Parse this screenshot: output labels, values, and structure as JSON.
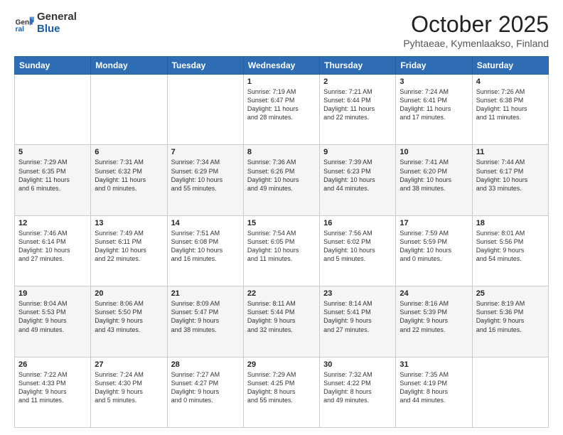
{
  "header": {
    "logo_general": "General",
    "logo_blue": "Blue",
    "title": "October 2025",
    "location": "Pyhtaeae, Kymenlaakso, Finland"
  },
  "weekdays": [
    "Sunday",
    "Monday",
    "Tuesday",
    "Wednesday",
    "Thursday",
    "Friday",
    "Saturday"
  ],
  "weeks": [
    [
      {
        "day": "",
        "info": ""
      },
      {
        "day": "",
        "info": ""
      },
      {
        "day": "",
        "info": ""
      },
      {
        "day": "1",
        "info": "Sunrise: 7:19 AM\nSunset: 6:47 PM\nDaylight: 11 hours\nand 28 minutes."
      },
      {
        "day": "2",
        "info": "Sunrise: 7:21 AM\nSunset: 6:44 PM\nDaylight: 11 hours\nand 22 minutes."
      },
      {
        "day": "3",
        "info": "Sunrise: 7:24 AM\nSunset: 6:41 PM\nDaylight: 11 hours\nand 17 minutes."
      },
      {
        "day": "4",
        "info": "Sunrise: 7:26 AM\nSunset: 6:38 PM\nDaylight: 11 hours\nand 11 minutes."
      }
    ],
    [
      {
        "day": "5",
        "info": "Sunrise: 7:29 AM\nSunset: 6:35 PM\nDaylight: 11 hours\nand 6 minutes."
      },
      {
        "day": "6",
        "info": "Sunrise: 7:31 AM\nSunset: 6:32 PM\nDaylight: 11 hours\nand 0 minutes."
      },
      {
        "day": "7",
        "info": "Sunrise: 7:34 AM\nSunset: 6:29 PM\nDaylight: 10 hours\nand 55 minutes."
      },
      {
        "day": "8",
        "info": "Sunrise: 7:36 AM\nSunset: 6:26 PM\nDaylight: 10 hours\nand 49 minutes."
      },
      {
        "day": "9",
        "info": "Sunrise: 7:39 AM\nSunset: 6:23 PM\nDaylight: 10 hours\nand 44 minutes."
      },
      {
        "day": "10",
        "info": "Sunrise: 7:41 AM\nSunset: 6:20 PM\nDaylight: 10 hours\nand 38 minutes."
      },
      {
        "day": "11",
        "info": "Sunrise: 7:44 AM\nSunset: 6:17 PM\nDaylight: 10 hours\nand 33 minutes."
      }
    ],
    [
      {
        "day": "12",
        "info": "Sunrise: 7:46 AM\nSunset: 6:14 PM\nDaylight: 10 hours\nand 27 minutes."
      },
      {
        "day": "13",
        "info": "Sunrise: 7:49 AM\nSunset: 6:11 PM\nDaylight: 10 hours\nand 22 minutes."
      },
      {
        "day": "14",
        "info": "Sunrise: 7:51 AM\nSunset: 6:08 PM\nDaylight: 10 hours\nand 16 minutes."
      },
      {
        "day": "15",
        "info": "Sunrise: 7:54 AM\nSunset: 6:05 PM\nDaylight: 10 hours\nand 11 minutes."
      },
      {
        "day": "16",
        "info": "Sunrise: 7:56 AM\nSunset: 6:02 PM\nDaylight: 10 hours\nand 5 minutes."
      },
      {
        "day": "17",
        "info": "Sunrise: 7:59 AM\nSunset: 5:59 PM\nDaylight: 10 hours\nand 0 minutes."
      },
      {
        "day": "18",
        "info": "Sunrise: 8:01 AM\nSunset: 5:56 PM\nDaylight: 9 hours\nand 54 minutes."
      }
    ],
    [
      {
        "day": "19",
        "info": "Sunrise: 8:04 AM\nSunset: 5:53 PM\nDaylight: 9 hours\nand 49 minutes."
      },
      {
        "day": "20",
        "info": "Sunrise: 8:06 AM\nSunset: 5:50 PM\nDaylight: 9 hours\nand 43 minutes."
      },
      {
        "day": "21",
        "info": "Sunrise: 8:09 AM\nSunset: 5:47 PM\nDaylight: 9 hours\nand 38 minutes."
      },
      {
        "day": "22",
        "info": "Sunrise: 8:11 AM\nSunset: 5:44 PM\nDaylight: 9 hours\nand 32 minutes."
      },
      {
        "day": "23",
        "info": "Sunrise: 8:14 AM\nSunset: 5:41 PM\nDaylight: 9 hours\nand 27 minutes."
      },
      {
        "day": "24",
        "info": "Sunrise: 8:16 AM\nSunset: 5:39 PM\nDaylight: 9 hours\nand 22 minutes."
      },
      {
        "day": "25",
        "info": "Sunrise: 8:19 AM\nSunset: 5:36 PM\nDaylight: 9 hours\nand 16 minutes."
      }
    ],
    [
      {
        "day": "26",
        "info": "Sunrise: 7:22 AM\nSunset: 4:33 PM\nDaylight: 9 hours\nand 11 minutes."
      },
      {
        "day": "27",
        "info": "Sunrise: 7:24 AM\nSunset: 4:30 PM\nDaylight: 9 hours\nand 5 minutes."
      },
      {
        "day": "28",
        "info": "Sunrise: 7:27 AM\nSunset: 4:27 PM\nDaylight: 9 hours\nand 0 minutes."
      },
      {
        "day": "29",
        "info": "Sunrise: 7:29 AM\nSunset: 4:25 PM\nDaylight: 8 hours\nand 55 minutes."
      },
      {
        "day": "30",
        "info": "Sunrise: 7:32 AM\nSunset: 4:22 PM\nDaylight: 8 hours\nand 49 minutes."
      },
      {
        "day": "31",
        "info": "Sunrise: 7:35 AM\nSunset: 4:19 PM\nDaylight: 8 hours\nand 44 minutes."
      },
      {
        "day": "",
        "info": ""
      }
    ]
  ]
}
